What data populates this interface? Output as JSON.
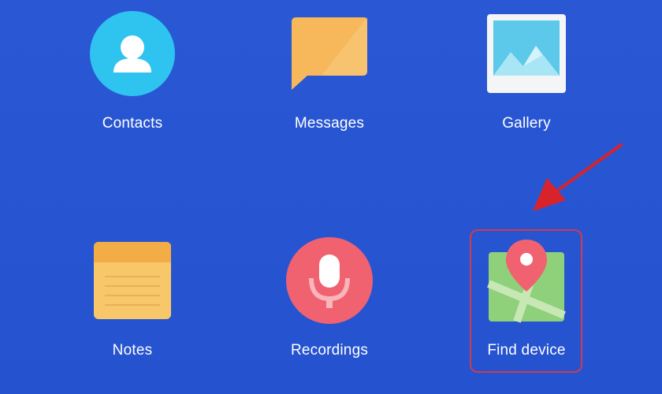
{
  "apps": {
    "contacts": {
      "label": "Contacts",
      "icon": "contacts-icon",
      "color": "#2fc3f0"
    },
    "messages": {
      "label": "Messages",
      "icon": "messages-icon",
      "color": "#f6b85a"
    },
    "gallery": {
      "label": "Gallery",
      "icon": "gallery-icon",
      "color": "#5cc8ea"
    },
    "notes": {
      "label": "Notes",
      "icon": "notes-icon",
      "color": "#f7c76a"
    },
    "recordings": {
      "label": "Recordings",
      "icon": "microphone-icon",
      "color": "#f06270"
    },
    "find_device": {
      "label": "Find device",
      "icon": "map-pin-icon",
      "color": "#8fd07a"
    }
  },
  "annotation": {
    "highlight_color": "#d23a4a",
    "arrow_icon": "arrow-pointer-icon"
  }
}
